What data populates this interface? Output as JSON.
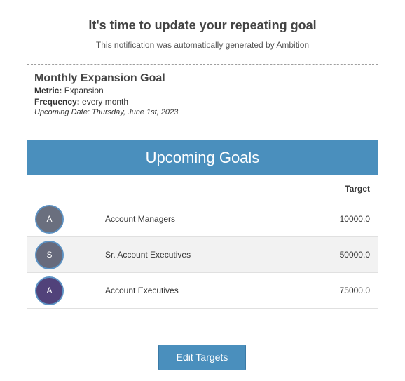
{
  "header": {
    "title": "It's time to update your repeating goal",
    "subtitle": "This notification was automatically generated by Ambition"
  },
  "goal": {
    "name": "Monthly Expansion Goal",
    "metric_label": "Metric:",
    "metric_value": "Expansion",
    "frequency_label": "Frequency:",
    "frequency_value": "every month",
    "upcoming_date": "Upcoming Date: Thursday, June 1st, 2023"
  },
  "upcoming": {
    "title": "Upcoming Goals",
    "target_header": "Target",
    "rows": [
      {
        "initial": "A",
        "name": "Account Managers",
        "target": "10000.0",
        "avatar_color": "#6a6f7e"
      },
      {
        "initial": "S",
        "name": "Sr. Account Executives",
        "target": "50000.0",
        "avatar_color": "#676a7c"
      },
      {
        "initial": "A",
        "name": "Account Executives",
        "target": "75000.0",
        "avatar_color": "#51427a"
      }
    ]
  },
  "actions": {
    "edit_targets_label": "Edit Targets"
  },
  "colors": {
    "accent": "#4a8fbd",
    "divider": "#9e9e9e",
    "row_alt": "#f2f2f2"
  }
}
